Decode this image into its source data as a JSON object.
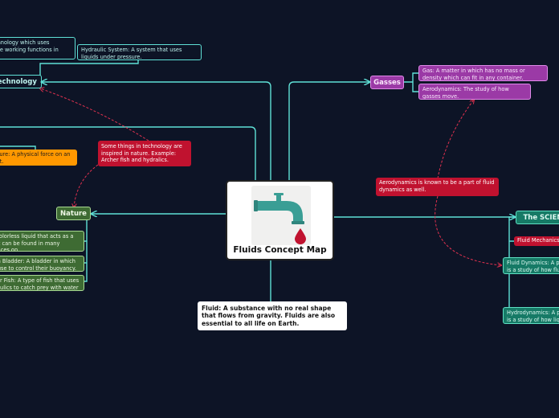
{
  "colors": {
    "background": "#0d1426",
    "connector": "#5fe0d6",
    "dashed_connector": "#e0314f",
    "gasses": "#9b3aa6",
    "nature": "#3e6b33",
    "science": "#167a66",
    "relation": "#c0122f",
    "pressure": "#ff9800"
  },
  "central": {
    "title": "Fluids Concept Map",
    "icon": "water-faucet-icon"
  },
  "fluid_definition": "Fluid: A substance with no real shape that flows from gravity. Fluids are also essential to all life on Earth.",
  "technology": {
    "label": "Technology",
    "notes": [
      "Hydraulics: Technology which uses hydraulics create working functions in",
      "Hydraulic System: A system that uses liquids under pressure."
    ],
    "pressure_note": "Pressure: A physical force on an object."
  },
  "gasses": {
    "label": "Gasses",
    "notes": [
      "Gas: A matter in which has no mass or density which can fit in any container.",
      "Aerodynamics: The study of how gasses move."
    ]
  },
  "nature": {
    "label": "Nature",
    "notes": [
      "Water: A colorless liquid that acts as a fluid and it can be found in many natural places on",
      "Swim Bladder: A bladder in which fish use to control their buoyancy.",
      "Archer Fish: A type of fish that uses hydraulics to catch prey with water away from plants."
    ]
  },
  "science": {
    "label": "The SCIENCE",
    "notes": [
      "Fluid Mechanics",
      "Fluid Dynamics: A part of Fluid Mechanics which is a study of how fluids move.",
      "Hydrodynamics: A part of Fluid Dynamics which is a study of how liquids move."
    ]
  },
  "relations": {
    "nature_tech": "Some things in technology are inspired in nature. Example: Archer fish and hydralics.",
    "aero": "Aerodynamics is known to be a part of fluid dynamics as well."
  }
}
